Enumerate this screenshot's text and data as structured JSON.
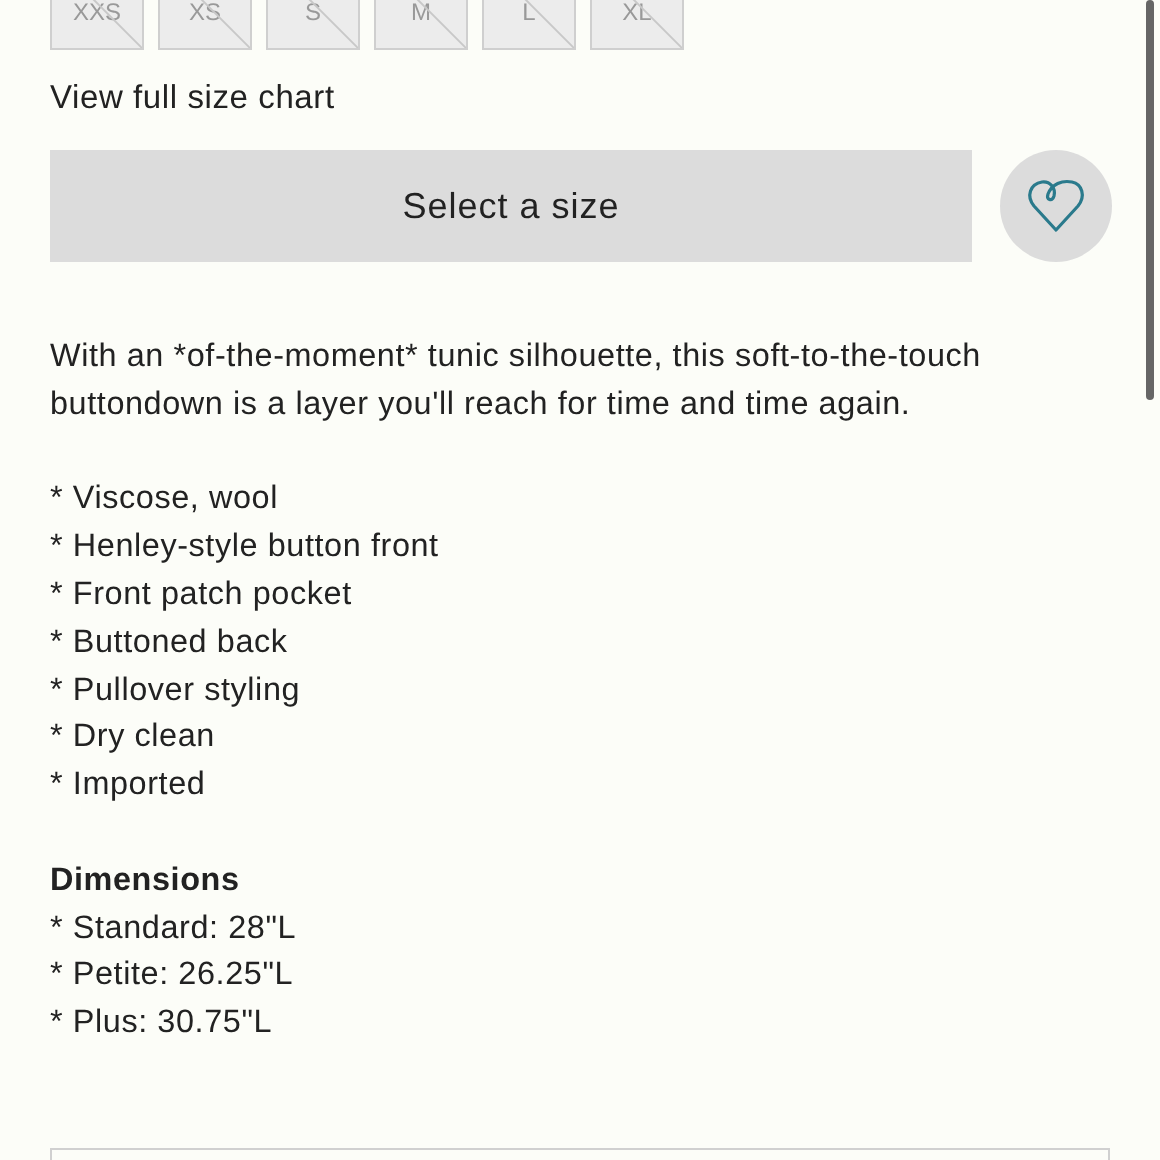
{
  "sizes": [
    {
      "label": "XXS",
      "disabled": true
    },
    {
      "label": "XS",
      "disabled": true
    },
    {
      "label": "S",
      "disabled": true
    },
    {
      "label": "M",
      "disabled": true
    },
    {
      "label": "L",
      "disabled": true
    },
    {
      "label": "XL",
      "disabled": true
    }
  ],
  "size_chart_link": "View full size chart",
  "select_button": "Select a size",
  "favorite": {
    "selected": false
  },
  "description": "With an *of-the-moment* tunic silhouette, this soft-to-the-touch buttondown is a layer you'll reach for time and time again.",
  "features": [
    "* Viscose, wool",
    "* Henley-style button front",
    "* Front patch pocket",
    "* Buttoned back",
    "* Pullover styling",
    "* Dry clean",
    "* Imported"
  ],
  "dimensions": {
    "heading": "Dimensions",
    "lines": [
      "* Standard: 28\"L",
      "* Petite: 26.25\"L",
      "* Plus: 30.75\"L"
    ]
  }
}
